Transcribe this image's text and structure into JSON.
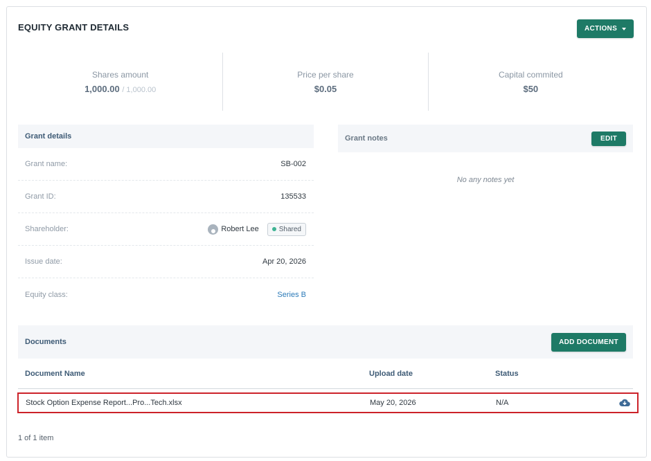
{
  "header": {
    "title": "EQUITY GRANT DETAILS",
    "actions_label": "ACTIONS"
  },
  "stats": [
    {
      "label": "Shares amount",
      "value": "1,000.00",
      "secondary": "/ 1,000.00"
    },
    {
      "label": "Price per share",
      "value": "$0.05"
    },
    {
      "label": "Capital commited",
      "value": "$50"
    }
  ],
  "grant_details": {
    "title": "Grant details",
    "grant_name_label": "Grant name:",
    "grant_name": "SB-002",
    "grant_id_label": "Grant ID:",
    "grant_id": "135533",
    "shareholder_label": "Shareholder:",
    "shareholder_name": "Robert Lee",
    "shareholder_badge": "Shared",
    "issue_date_label": "Issue date:",
    "issue_date": "Apr 20, 2026",
    "equity_class_label": "Equity class:",
    "equity_class": "Series B"
  },
  "grant_notes": {
    "title": "Grant notes",
    "edit_label": "EDIT",
    "empty_text": "No any notes yet"
  },
  "documents": {
    "title": "Documents",
    "add_label": "ADD DOCUMENT",
    "columns": {
      "name": "Document Name",
      "date": "Upload date",
      "status": "Status"
    },
    "rows": [
      {
        "name": "Stock Option Expense Report...Pro...Tech.xlsx",
        "date": "May 20, 2026",
        "status": "N/A",
        "action_icon": "cloud-download-icon"
      }
    ],
    "count_text": "1 of 1 item"
  },
  "colors": {
    "accent": "#1e7a66",
    "highlight": "#cc2229",
    "link": "#2b7ab8",
    "shared_dot": "#3eb393"
  }
}
